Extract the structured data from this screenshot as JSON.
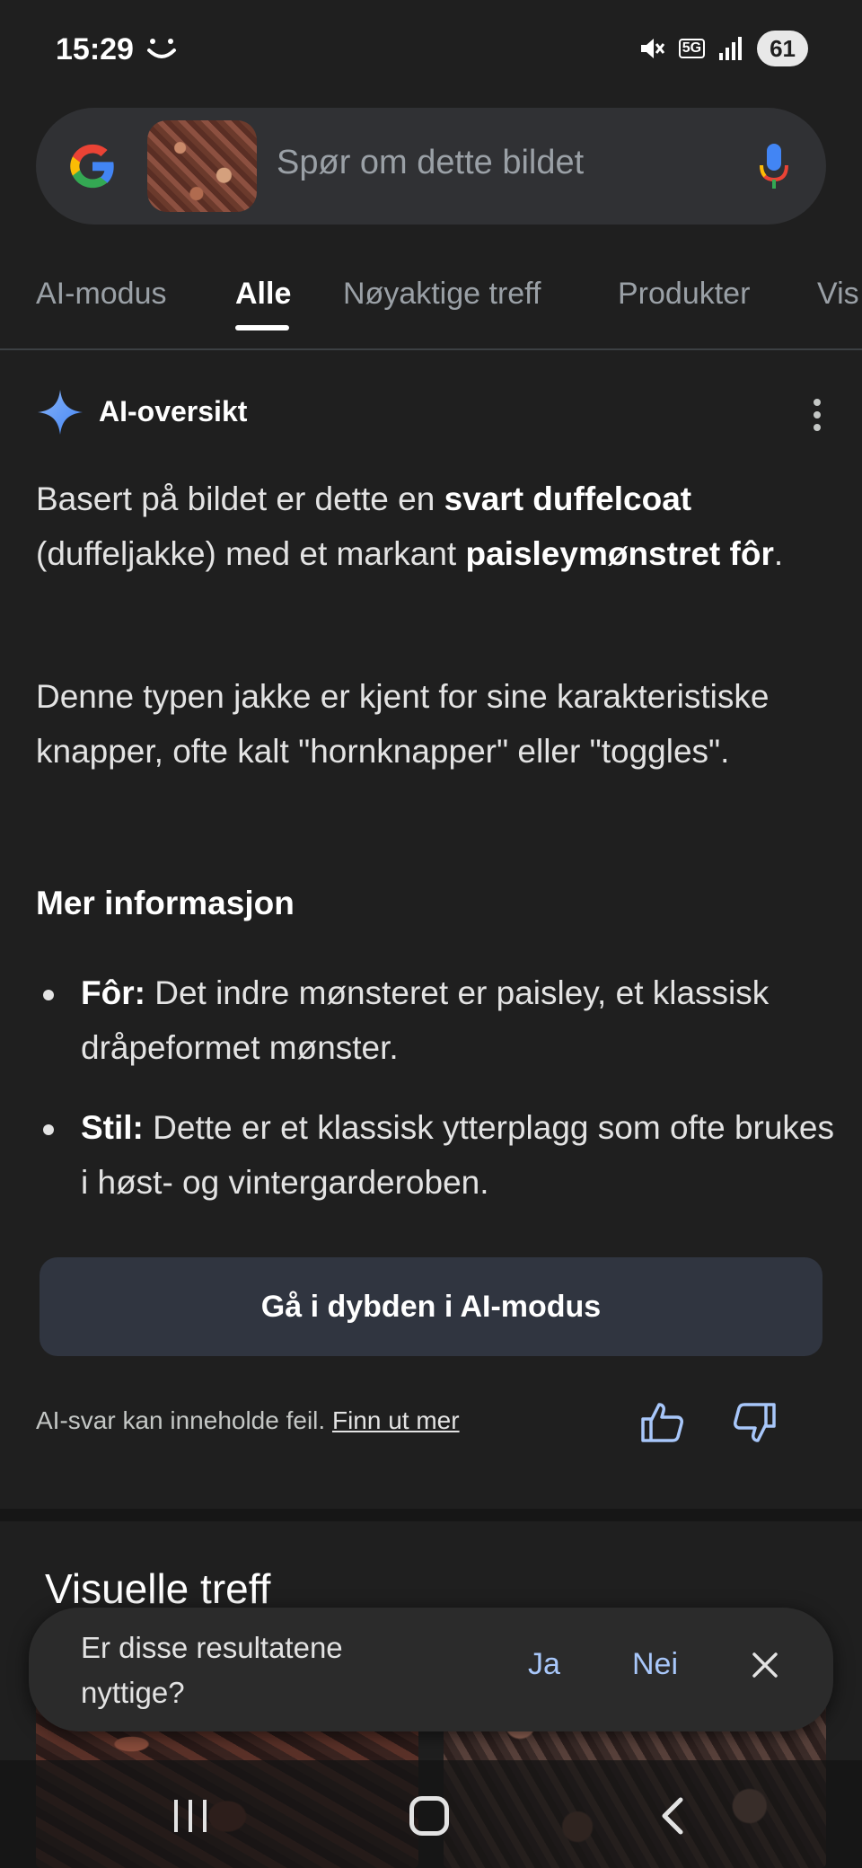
{
  "status_bar": {
    "time": "15:29",
    "network": "5G",
    "battery": "61"
  },
  "search": {
    "placeholder": "Spør om dette bildet"
  },
  "tabs": [
    {
      "label": "AI-modus"
    },
    {
      "label": "Alle",
      "active": true
    },
    {
      "label": "Nøyaktige treff"
    },
    {
      "label": "Produkter"
    },
    {
      "label": "Vis"
    }
  ],
  "ai_overview": {
    "title": "AI-oversikt",
    "para1": {
      "t1": "Basert på bildet er dette en ",
      "b1": "svart duffelcoat",
      "t2": " (duffeljakke) med et markant ",
      "b2": "paisleymønstret fôr",
      "t3": "."
    },
    "para2": "Denne typen jakke er kjent for sine karakteristiske knapper, ofte kalt \"hornknapper\" eller \"toggles\".",
    "more_heading": "Mer informasjon",
    "bullets": [
      {
        "label": "Fôr:",
        "text": " Det indre mønsteret er paisley, et klassisk dråpeformet mønster."
      },
      {
        "label": "Stil:",
        "text": " Dette er et klassisk ytterplagg som ofte brukes i høst- og vintergarderoben."
      }
    ],
    "deep_dive_button": "Gå i dybden i AI-modus",
    "disclaimer": "AI-svar kan inneholde feil. ",
    "learn_more": "Finn ut mer"
  },
  "visual_matches": {
    "title": "Visuelle treff"
  },
  "feedback": {
    "question": "Er disse resultatene nyttige?",
    "yes": "Ja",
    "no": "Nei"
  },
  "colors": {
    "background": "#1f1f1f",
    "accent_link": "#a8c7fa",
    "button_bg": "#303540"
  }
}
